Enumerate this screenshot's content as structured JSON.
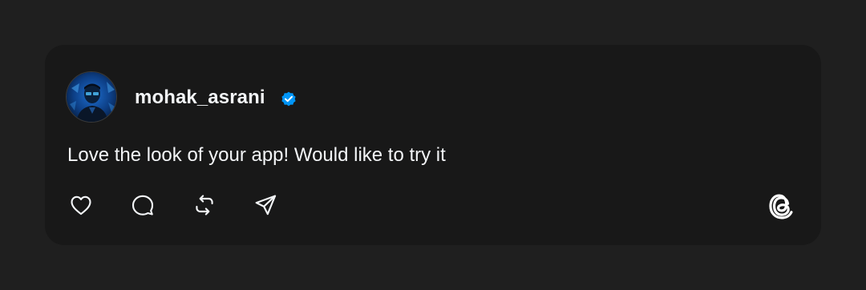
{
  "post": {
    "username": "mohak_asrani",
    "verified": true,
    "text": "Love the look of your app! Would like to try it"
  },
  "actions": [
    {
      "icon": "heart-icon"
    },
    {
      "icon": "comment-icon"
    },
    {
      "icon": "repost-icon"
    },
    {
      "icon": "share-icon"
    }
  ],
  "brand": {
    "icon": "threads-logo-icon"
  },
  "colors": {
    "page_background": "#1f1f1f",
    "card_background": "#181818",
    "text": "#f3f5f7",
    "verified_badge": "#0095f6"
  }
}
